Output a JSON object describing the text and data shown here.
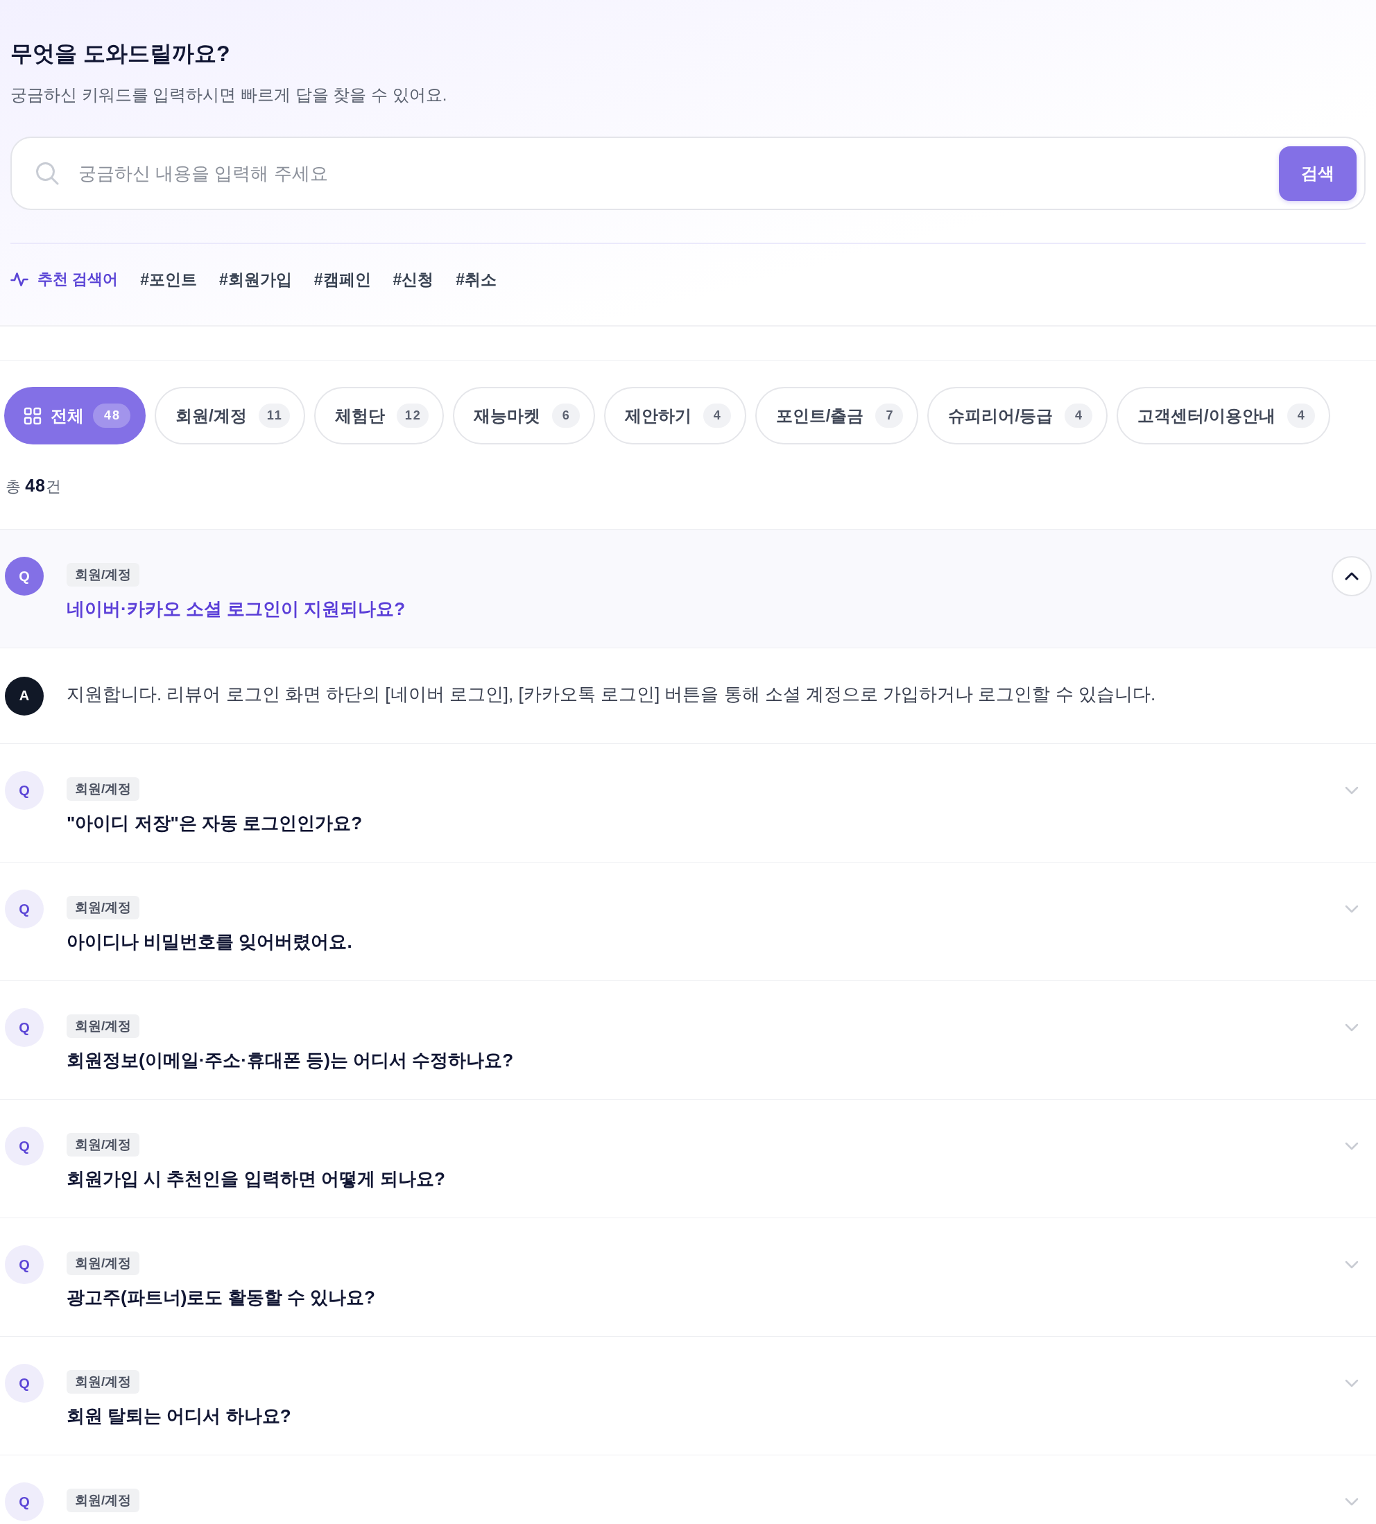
{
  "header": {
    "title": "무엇을 도와드릴까요?",
    "subtitle": "궁금하신 키워드를 입력하시면 빠르게 답을 찾을 수 있어요."
  },
  "search": {
    "placeholder": "궁금하신 내용을 입력해 주세요",
    "button": "검색"
  },
  "recommended": {
    "label": "추천 검색어",
    "keywords": [
      "#포인트",
      "#회원가입",
      "#캠페인",
      "#신청",
      "#취소"
    ]
  },
  "categories": [
    {
      "kind": "all",
      "label": "전체",
      "count": "48",
      "selected": true
    },
    {
      "kind": "category",
      "label": "회원/계정",
      "count": "11",
      "selected": false
    },
    {
      "kind": "category",
      "label": "체험단",
      "count": "12",
      "selected": false
    },
    {
      "kind": "category",
      "label": "재능마켓",
      "count": "6",
      "selected": false
    },
    {
      "kind": "category",
      "label": "제안하기",
      "count": "4",
      "selected": false
    },
    {
      "kind": "category",
      "label": "포인트/출금",
      "count": "7",
      "selected": false
    },
    {
      "kind": "category",
      "label": "슈피리어/등급",
      "count": "4",
      "selected": false
    },
    {
      "kind": "category",
      "label": "고객센터/이용안내",
      "count": "4",
      "selected": false
    }
  ],
  "total": "총 **48**건",
  "faqs": [
    {
      "badge": "Q",
      "tag": "회원/계정",
      "question": "네이버·카카오 소셜 로그인이 지원되나요?",
      "expanded": true,
      "answer_badge": "A",
      "answer": "지원합니다. 리뷰어 로그인 화면 하단의 [네이버 로그인], [카카오톡 로그인] 버튼을 통해 소셜 계정으로 가입하거나 로그인할 수 있습니다."
    },
    {
      "badge": "Q",
      "tag": "회원/계정",
      "question": "\"아이디 저장\"은 자동 로그인인가요?",
      "expanded": false
    },
    {
      "badge": "Q",
      "tag": "회원/계정",
      "question": "아이디나 비밀번호를 잊어버렸어요.",
      "expanded": false
    },
    {
      "badge": "Q",
      "tag": "회원/계정",
      "question": "회원정보(이메일·주소·휴대폰 등)는 어디서 수정하나요?",
      "expanded": false
    },
    {
      "badge": "Q",
      "tag": "회원/계정",
      "question": "회원가입 시 추천인을 입력하면 어떻게 되나요?",
      "expanded": false
    },
    {
      "badge": "Q",
      "tag": "회원/계정",
      "question": "광고주(파트너)로도 활동할 수 있나요?",
      "expanded": false
    },
    {
      "badge": "Q",
      "tag": "회원/계정",
      "question": "회원 탈퇴는 어디서 하나요?",
      "expanded": false
    },
    {
      "badge": "Q",
      "tag": "회원/계정",
      "expanded": false
    }
  ]
}
